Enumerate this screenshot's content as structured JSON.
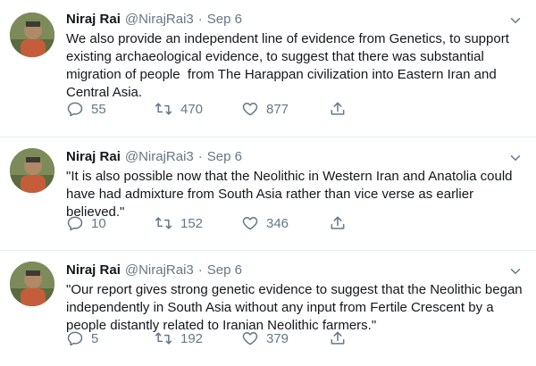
{
  "tweets": [
    {
      "author_name": "Niraj Rai",
      "handle": "@NirajRai3",
      "separator": "·",
      "date": "Sep 6",
      "text": "We also provide an independent line of evidence from Genetics, to support existing archaeological evidence, to suggest that there was substantial migration of people  from The Harappan civilization into Eastern Iran and Central Asia.",
      "replies": "55",
      "retweets": "470",
      "likes": "877"
    },
    {
      "author_name": "Niraj Rai",
      "handle": "@NirajRai3",
      "separator": "·",
      "date": "Sep 6",
      "text": "\"It is also possible now that the Neolithic in Western Iran and Anatolia could have had admixture from South Asia rather than vice verse as earlier believed.\"",
      "replies": "10",
      "retweets": "152",
      "likes": "346"
    },
    {
      "author_name": "Niraj Rai",
      "handle": "@NirajRai3",
      "separator": "·",
      "date": "Sep 6",
      "text": "\"Our report gives strong genetic evidence to suggest that the Neolithic began independently in South Asia without any input from Fertile Crescent by a people distantly related to Iranian Neolithic farmers.\"",
      "replies": "5",
      "retweets": "192",
      "likes": "379"
    }
  ],
  "icons": {
    "reply": "reply-icon",
    "retweet": "retweet-icon",
    "like": "heart-icon",
    "share": "share-icon",
    "caret": "chevron-down-icon"
  },
  "colors": {
    "text_primary": "#14171a",
    "text_secondary": "#657786",
    "divider": "#e6ecf0"
  }
}
